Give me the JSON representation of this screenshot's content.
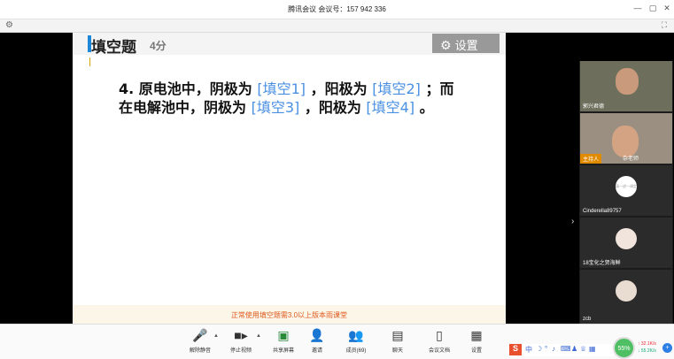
{
  "window": {
    "title": "腾讯会议 会议号：157 942 336",
    "controls": [
      "—",
      "▢",
      "✕"
    ]
  },
  "slide": {
    "heading": "填空题",
    "score": "4分",
    "settings_label": "设置",
    "question": {
      "number": "4.",
      "parts": [
        {
          "type": "text",
          "value": "原电池中，阴极为 "
        },
        {
          "type": "blank",
          "value": "[填空1]"
        },
        {
          "type": "text",
          "value": " ，阳极为 "
        },
        {
          "type": "blank",
          "value": "[填空2]"
        },
        {
          "type": "text",
          "value": " ；而在电解池中，阴极为 "
        },
        {
          "type": "blank",
          "value": "[填空3]"
        },
        {
          "type": "text",
          "value": " ，阳极为 "
        },
        {
          "type": "blank",
          "value": "[填空4]"
        },
        {
          "type": "text",
          "value": " 。"
        }
      ]
    },
    "footer_note": "正常使用填空题需3.0以上版本雨课堂"
  },
  "participants": [
    {
      "name": "郭兴君德",
      "kind": "video"
    },
    {
      "name": "杂老师",
      "kind": "video",
      "host_label": "主持人"
    },
    {
      "name": "Cinderella89757",
      "kind": "avatar",
      "avatar_text": "请一进一调定"
    },
    {
      "name": "18宝化之贺海鲜",
      "kind": "photo"
    },
    {
      "name": "zcb",
      "kind": "photo"
    }
  ],
  "toolbar": {
    "items": [
      {
        "label": "解除静音",
        "icon": "mic-muted-icon"
      },
      {
        "label": "停止视频",
        "icon": "camera-icon"
      },
      {
        "label": "共享屏幕",
        "icon": "screen-share-icon"
      },
      {
        "label": "邀请",
        "icon": "invite-icon"
      },
      {
        "label": "成员(69)",
        "icon": "members-icon"
      },
      {
        "label": "聊天",
        "icon": "chat-icon"
      },
      {
        "label": "会议文档",
        "icon": "document-icon"
      },
      {
        "label": "设置",
        "icon": "settings-icon"
      }
    ]
  },
  "network": {
    "percent": "55%",
    "upload": "32.1K/s",
    "download": "55.2K/s"
  },
  "colors": {
    "blank": "#4a90e2",
    "accent_bar": "#1e88d8",
    "footer_text": "#e05a20"
  }
}
